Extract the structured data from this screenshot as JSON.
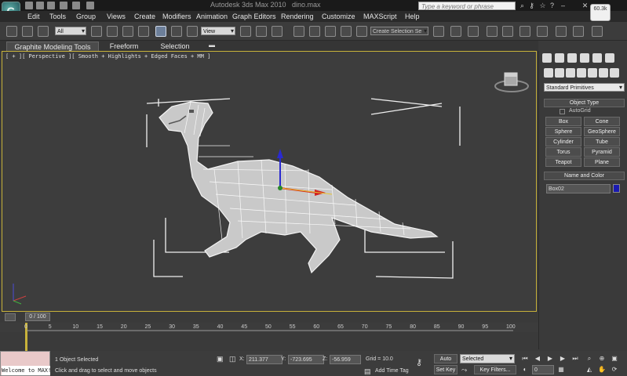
{
  "window": {
    "title_app": "Autodesk 3ds Max 2010",
    "title_file": "dino.max",
    "search_placeholder": "Type a keyword or phrase",
    "logo_glyph": "G"
  },
  "menu": [
    "Edit",
    "Tools",
    "Group",
    "Views",
    "Create",
    "Modifiers",
    "Animation",
    "Graph Editors",
    "Rendering",
    "Customize",
    "MAXScript",
    "Help"
  ],
  "toolbar": {
    "filter_value": "All",
    "refcoord_value": "View",
    "snap_label": "3",
    "selection_set_placeholder": "Create Selection Se",
    "badge_text": "60.3k"
  },
  "ribbon": {
    "tabs": [
      "Graphite Modeling Tools",
      "Freeform",
      "Selection"
    ]
  },
  "viewport": {
    "label": "[ + ][ Perspective ][ Smooth + Highlights + Edged Faces + MM ]"
  },
  "command_panel": {
    "category_value": "Standard Primitives",
    "object_type_title": "Object Type",
    "autogrid_label": "AutoGrid",
    "objects": [
      "Box",
      "Cone",
      "Sphere",
      "GeoSphere",
      "Cylinder",
      "Tube",
      "Torus",
      "Pyramid",
      "Teapot",
      "Plane"
    ],
    "name_color_title": "Name and Color",
    "name_value": "Box02",
    "color": "#1a1ab0"
  },
  "timeline": {
    "slider_label": "0 / 100",
    "ticks": [
      "0",
      "5",
      "10",
      "15",
      "20",
      "25",
      "30",
      "35",
      "40",
      "45",
      "50",
      "55",
      "60",
      "65",
      "70",
      "75",
      "80",
      "85",
      "90",
      "95",
      "100"
    ]
  },
  "status": {
    "maxscript_text": "Welcome to MAX!",
    "selected_count": "1 Object Selected",
    "prompt": "Click and drag to select and move objects",
    "x_label": "X:",
    "x_value": "211.377",
    "y_label": "Y:",
    "y_value": "-723.695",
    "z_label": "Z:",
    "z_value": "-56.959",
    "grid": "Grid = 10.0",
    "add_time_tag": "Add Time Tag",
    "auto_key": "Auto Key",
    "set_key": "Set Key",
    "selected_dropdown": "Selected",
    "key_filters": "Key Filters...",
    "frame_value": "0"
  }
}
